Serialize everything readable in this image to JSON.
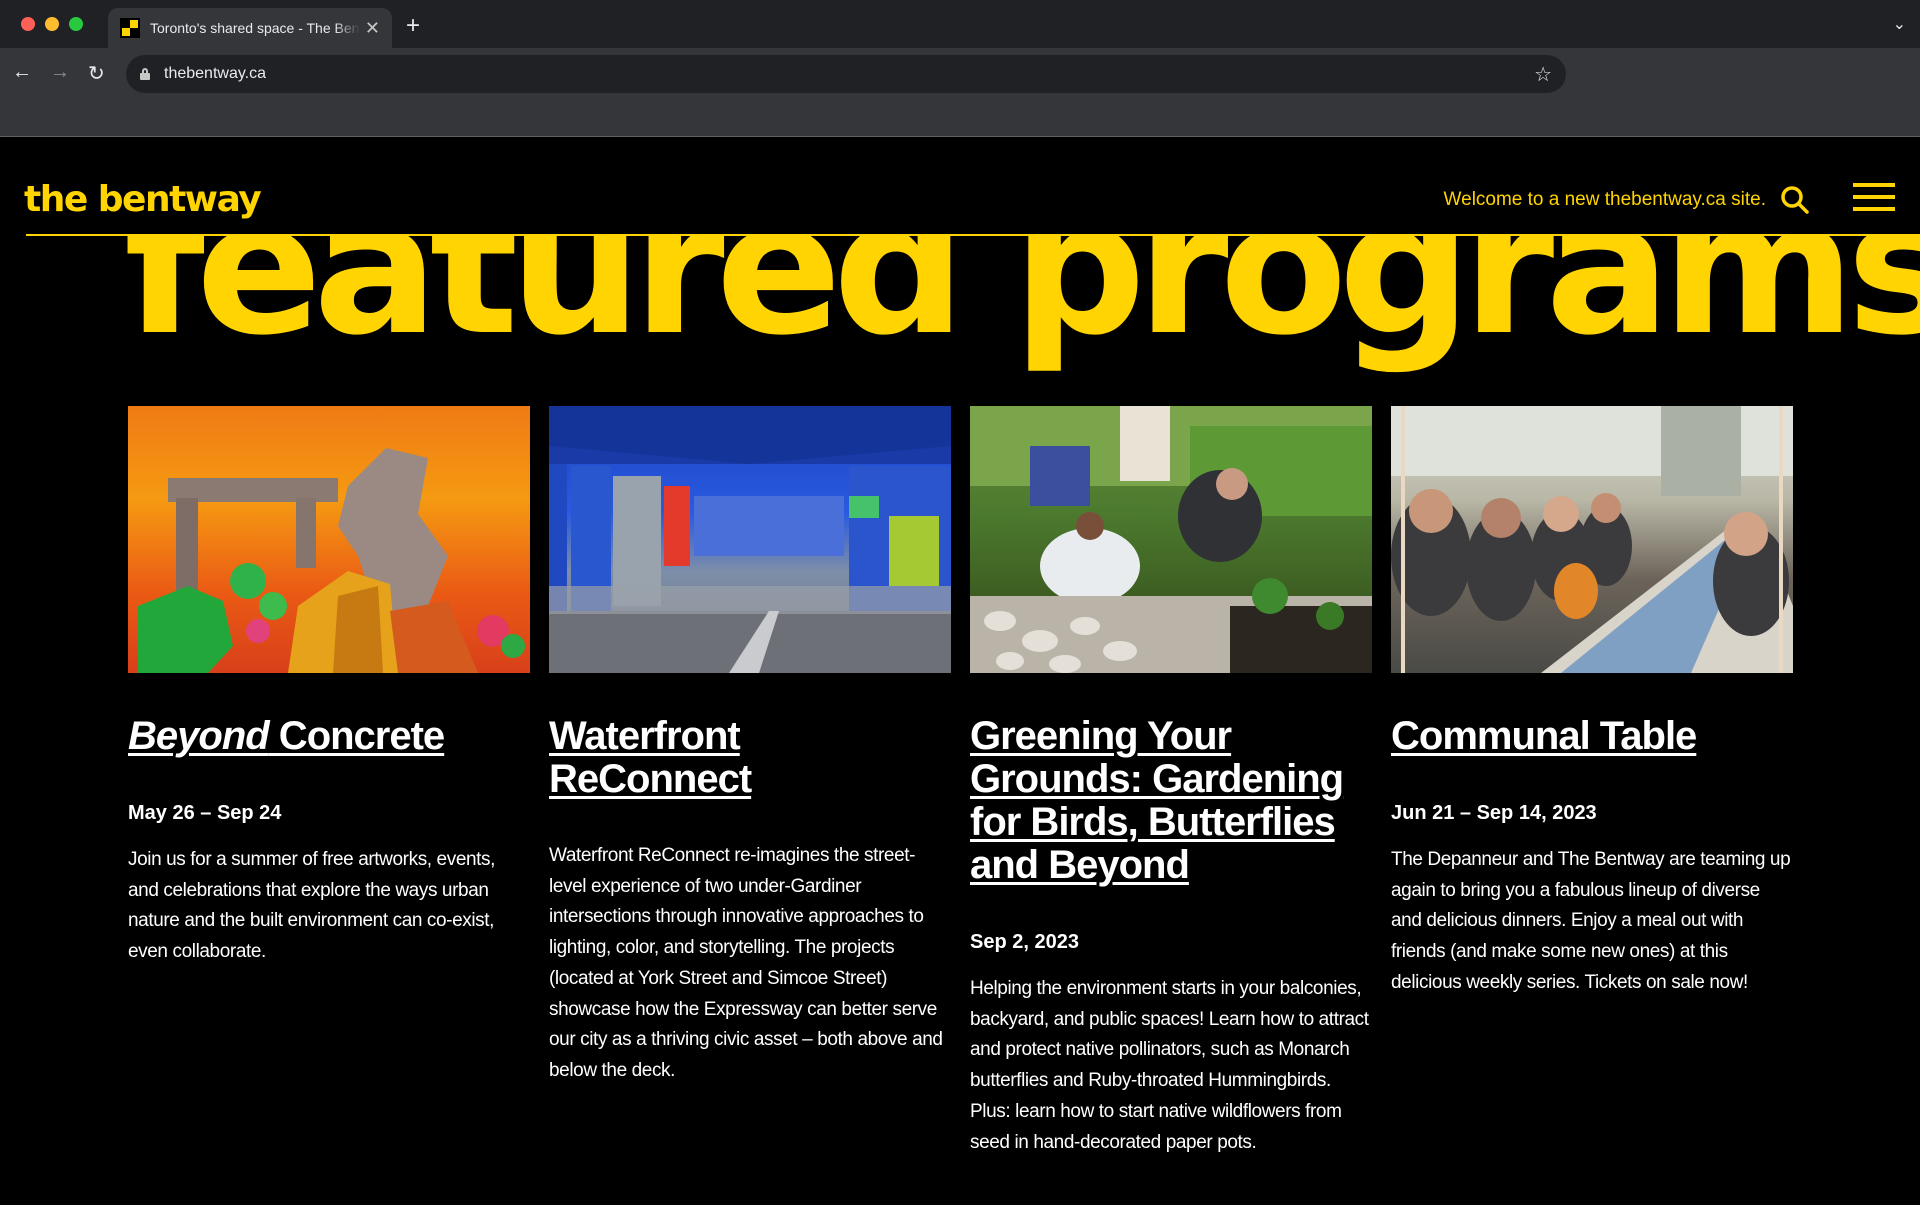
{
  "browser": {
    "tab_title": "Toronto's shared space - The Bentway",
    "url": "thebentway.ca",
    "new_tab": "+",
    "tab_close": "✕"
  },
  "site": {
    "logo": "the bentway",
    "welcome": "Welcome to a new thebentway.ca site.",
    "heading": "featured programs",
    "brand_color": "#ffd400"
  },
  "cards": [
    {
      "title_em": "Beyond",
      "title_rest": " Concrete",
      "date": "May 26 – Sep 24",
      "description": "Join us for a summer of free artworks, events, and celebrations that explore the ways urban nature and the built environment can co-exist, even collaborate."
    },
    {
      "title": "Waterfront ReConnect",
      "date": "",
      "description": "Waterfront ReConnect re-imagines the street-level experience of two under-Gardiner intersections through innovative approaches to lighting, color, and storytelling. The projects (located at York Street and Simcoe Street) showcase how the Expressway can better serve our city as a thriving civic asset – both above and below the deck."
    },
    {
      "title": "Greening Your Grounds: Gardening for Birds, Butterflies and Beyond",
      "date": "Sep 2, 2023",
      "description": "Helping the environment starts in your balconies, backyard, and public spaces! Learn how to attract and protect native pollinators, such as Monarch butterflies and Ruby-throated Hummingbirds. Plus: learn how to start native wildflowers from seed in hand-decorated paper pots."
    },
    {
      "title": "Communal Table",
      "date": "Jun 21 – Sep 14, 2023",
      "description": "The Depanneur and The Bentway are teaming up again to bring you a fabulous lineup of diverse and delicious dinners. Enjoy a meal out with friends (and make some new ones) at this delicious weekly series. Tickets on sale now!"
    }
  ]
}
